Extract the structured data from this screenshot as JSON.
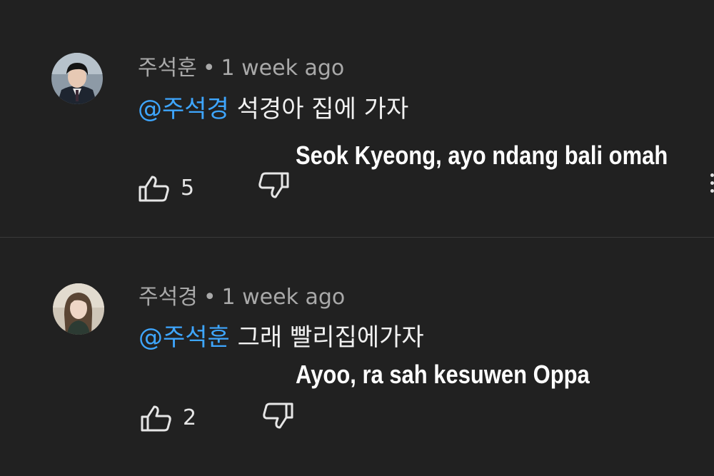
{
  "comments": [
    {
      "author": "주석훈",
      "separator": "•",
      "time": "1 week ago",
      "mention": "@주석경",
      "text": "석경아 집에 가자",
      "translation": "Seok Kyeong, ayo ndang bali omah",
      "likes": "5",
      "avatar_icon": "avatar-boy-uniform-icon"
    },
    {
      "author": "주석경",
      "separator": "•",
      "time": "1 week ago",
      "mention": "@주석훈",
      "text": "그래 빨리집에가자",
      "translation": "Ayoo, ra sah kesuwen Oppa",
      "likes": "2",
      "avatar_icon": "avatar-girl-icon"
    }
  ],
  "colors": {
    "background": "#212121",
    "mention": "#3ea6ff",
    "meta": "#a9a9a9"
  }
}
